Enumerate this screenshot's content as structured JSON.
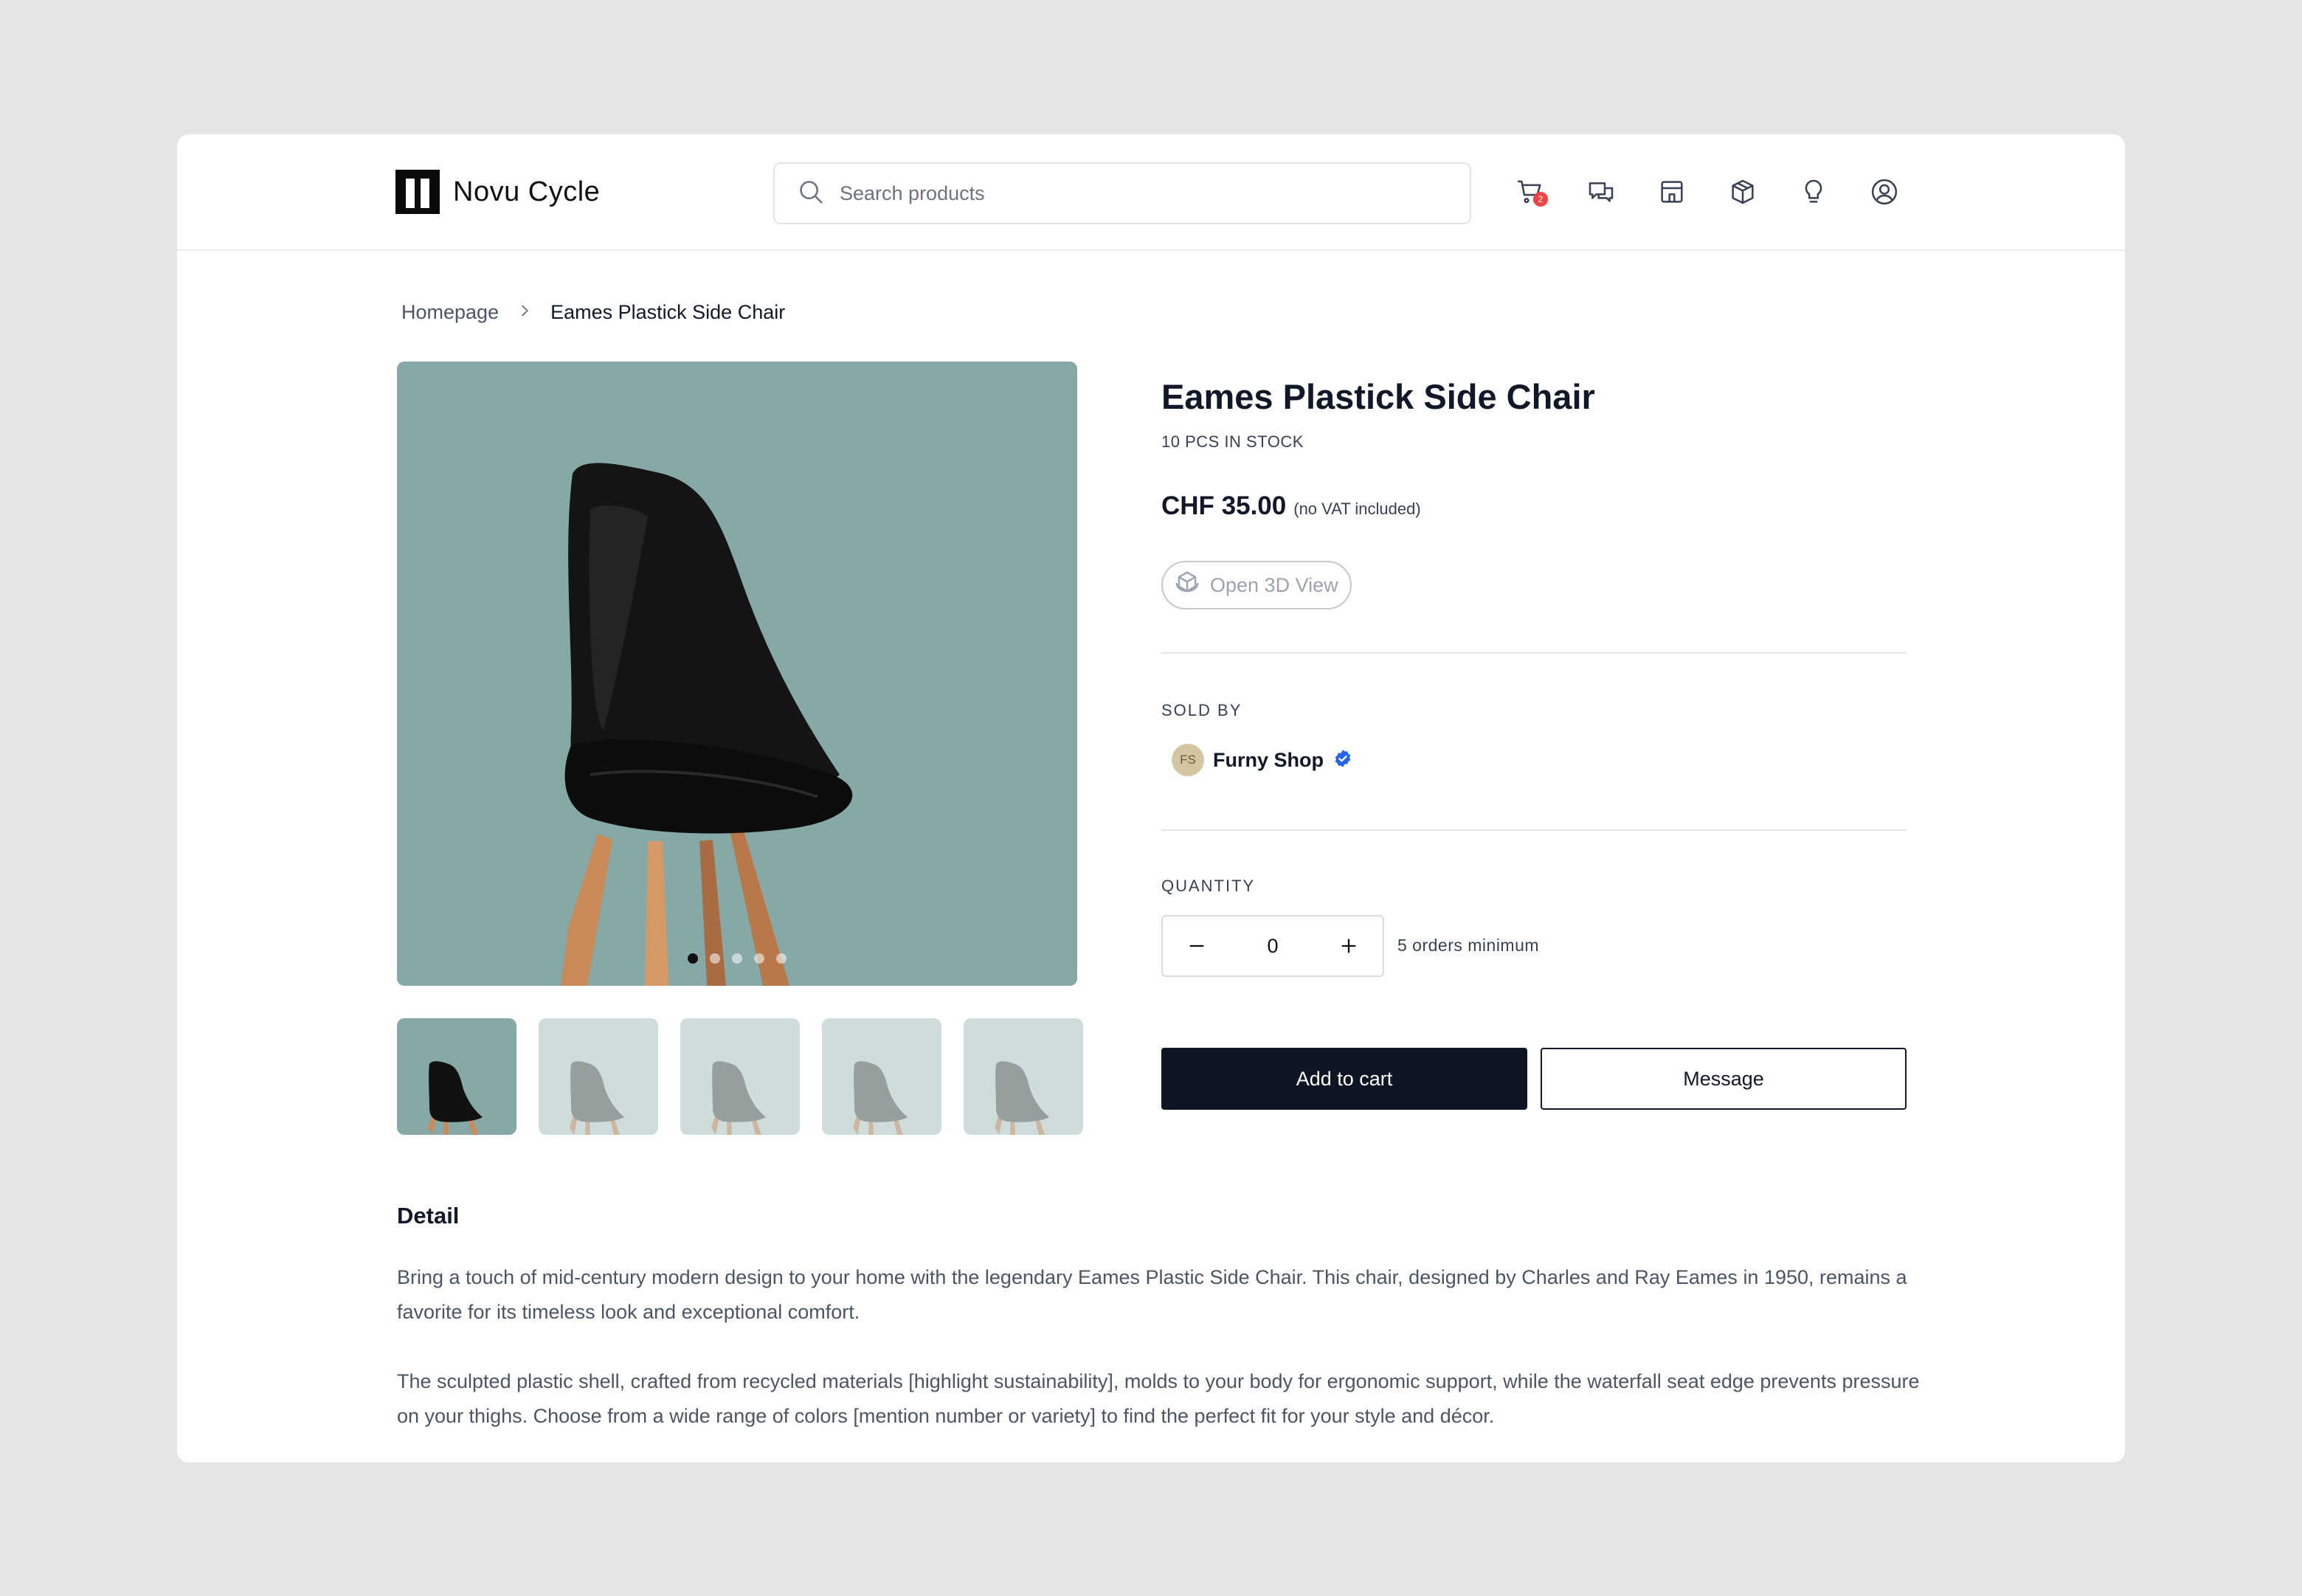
{
  "header": {
    "brand": "Novu Cycle",
    "search_placeholder": "Search products",
    "cart_badge": "2",
    "icons": [
      "cart-icon",
      "chat-icon",
      "store-icon",
      "box-icon",
      "lightbulb-icon",
      "user-icon"
    ]
  },
  "breadcrumb": {
    "home": "Homepage",
    "current": "Eames Plastick Side Chair"
  },
  "gallery": {
    "dot_count": 5,
    "active_index": 0,
    "thumbnail_count": 5
  },
  "product": {
    "title": "Eames Plastick Side Chair",
    "stock": "10 PCS IN STOCK",
    "price": "CHF 35.00",
    "price_note": "(no VAT included)",
    "view_3d_label": "Open 3D View"
  },
  "seller": {
    "label": "SOLD BY",
    "initials": "FS",
    "name": "Furny Shop",
    "verified": true
  },
  "quantity": {
    "label": "QUANTITY",
    "value": "0",
    "min_note": "5 orders minimum"
  },
  "actions": {
    "add_to_cart": "Add to cart",
    "message": "Message"
  },
  "detail": {
    "heading": "Detail",
    "paragraph1": "Bring a touch of mid-century modern design to your home with the legendary Eames Plastic Side Chair. This chair, designed by Charles and Ray Eames in 1950, remains a favorite for its timeless look and exceptional comfort.",
    "paragraph2": "The sculpted plastic shell, crafted from recycled materials [highlight sustainability], molds to your body for ergonomic support, while the waterfall seat edge prevents pressure on your thighs. Choose from a wide range of colors [mention number or variety] to find the perfect fit for your style and décor."
  },
  "colors": {
    "page_bg": "#e6e5e3",
    "image_bg": "#86a9a8",
    "primary_button": "#0f1623",
    "verified_blue": "#2563eb",
    "badge_red": "#ef4444"
  }
}
